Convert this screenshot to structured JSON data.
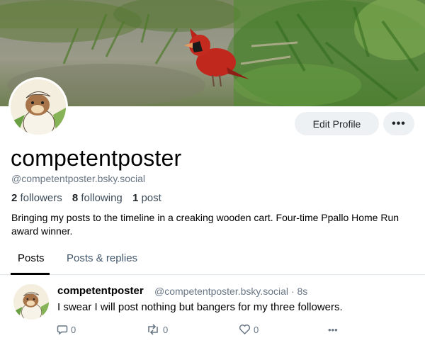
{
  "profile": {
    "display_name": "competentposter",
    "handle": "@competentposter.bsky.social",
    "followers_count": "2",
    "followers_label": "followers",
    "following_count": "8",
    "following_label": "following",
    "posts_count": "1",
    "posts_label": "post",
    "bio": "Bringing my posts to the timeline in a creaking wooden cart. Four-time Ppallo Home Run award winner.",
    "edit_button": "Edit Profile",
    "more_button": "•••"
  },
  "tabs": [
    {
      "label": "Posts",
      "active": true
    },
    {
      "label": "Posts & replies",
      "active": false
    }
  ],
  "post": {
    "author": "competentposter",
    "handle": "@competentposter.bsky.social",
    "separator": "·",
    "time": "8s",
    "text": "I swear I will post nothing but bangers for my three followers.",
    "reply_count": "0",
    "repost_count": "0",
    "like_count": "0",
    "more": "•••"
  },
  "icons": {
    "reply": "reply-icon",
    "repost": "repost-icon",
    "like": "heart-icon",
    "more": "more-icon"
  },
  "colors": {
    "secondary_text": "#687684",
    "button_bg": "#eef1f4",
    "divider": "#e1e6ea",
    "cardinal_red": "#c0281e"
  }
}
